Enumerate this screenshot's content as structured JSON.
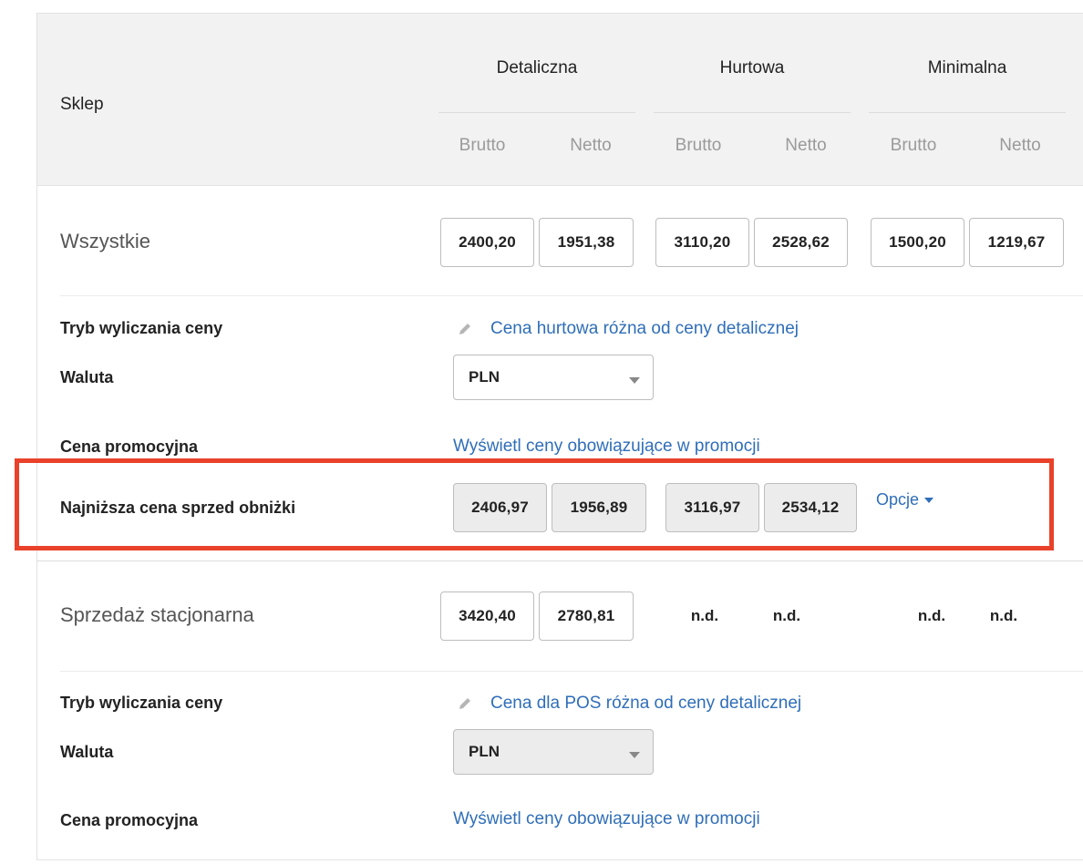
{
  "header": {
    "store_label": "Sklep",
    "groups": [
      {
        "label": "Detaliczna",
        "brutto": "Brutto",
        "netto": "Netto"
      },
      {
        "label": "Hurtowa",
        "brutto": "Brutto",
        "netto": "Netto"
      },
      {
        "label": "Minimalna",
        "brutto": "Brutto",
        "netto": "Netto"
      }
    ]
  },
  "rows": {
    "all": {
      "title": "Wszystkie",
      "prices": [
        "2400,20",
        "1951,38",
        "3110,20",
        "2528,62",
        "1500,20",
        "1219,67"
      ],
      "calc_mode_label": "Tryb wyliczania ceny",
      "calc_mode_link": "Cena hurtowa różna od ceny detalicznej",
      "currency_label": "Waluta",
      "currency_value": "PLN",
      "promo_label": "Cena promocyjna",
      "promo_link": "Wyświetl ceny obowiązujące w promocji",
      "lowest_label": "Najniższa cena sprzed obniżki",
      "lowest_prices": [
        "2406,97",
        "1956,89",
        "3116,97",
        "2534,12"
      ],
      "options_label": "Opcje"
    },
    "stationary": {
      "title": "Sprzedaż stacjonarna",
      "prices": [
        "3420,40",
        "2780,81"
      ],
      "na": [
        "n.d.",
        "n.d.",
        "n.d.",
        "n.d."
      ],
      "calc_mode_label": "Tryb wyliczania ceny",
      "calc_mode_link": "Cena dla POS różna od ceny detalicznej",
      "currency_label": "Waluta",
      "currency_value": "PLN",
      "promo_label": "Cena promocyjna",
      "promo_link": "Wyświetl ceny obowiązujące w promocji"
    }
  },
  "colors": {
    "link": "#2f6eb8",
    "highlight": "#e9412a",
    "header_bg": "#f2f2f2",
    "disabled_bg": "#ececec"
  }
}
